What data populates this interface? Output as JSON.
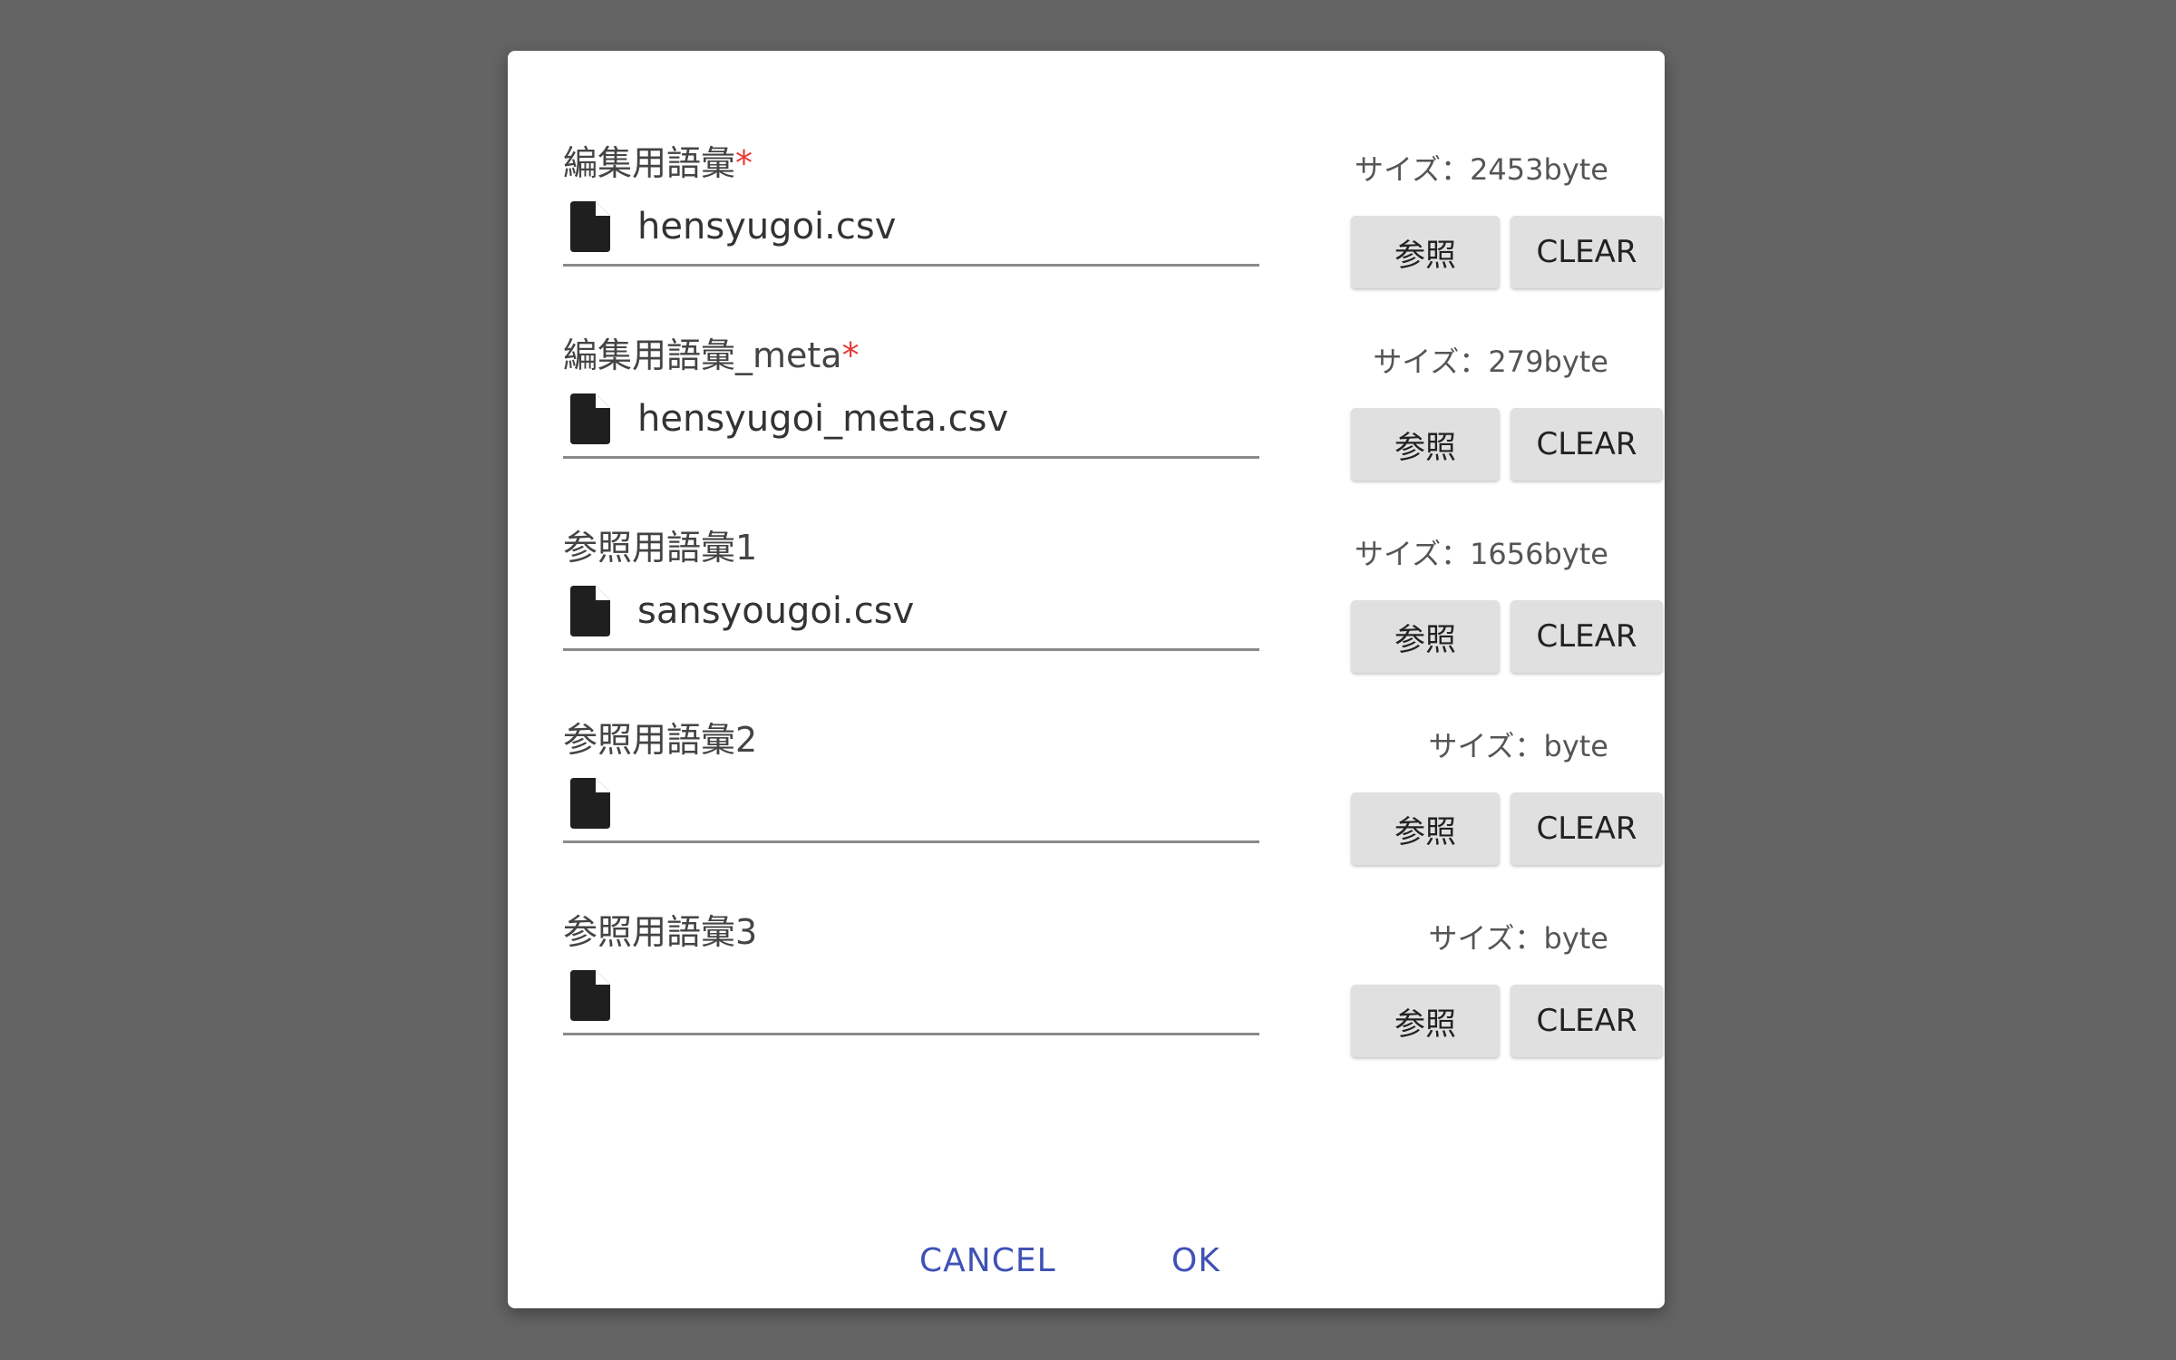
{
  "fields": [
    {
      "label": "編集用語彙",
      "required_mark": "*",
      "size_text": "サイズ：2453byte",
      "file_name": "hensyugoi.csv",
      "browse_label": "参照",
      "clear_label": "CLEAR"
    },
    {
      "label": "編集用語彙_meta",
      "required_mark": "*",
      "size_text": "サイズ：279byte",
      "file_name": "hensyugoi_meta.csv",
      "browse_label": "参照",
      "clear_label": "CLEAR"
    },
    {
      "label": "参照用語彙1",
      "required_mark": "",
      "size_text": "サイズ：1656byte",
      "file_name": "sansyougoi.csv",
      "browse_label": "参照",
      "clear_label": "CLEAR"
    },
    {
      "label": "参照用語彙2",
      "required_mark": "",
      "size_text": "サイズ：byte",
      "file_name": "",
      "browse_label": "参照",
      "clear_label": "CLEAR"
    },
    {
      "label": "参照用語彙3",
      "required_mark": "",
      "size_text": "サイズ：byte",
      "file_name": "",
      "browse_label": "参照",
      "clear_label": "CLEAR"
    }
  ],
  "actions": {
    "cancel_label": "CANCEL",
    "ok_label": "OK"
  },
  "icons": {
    "file": "file-icon"
  },
  "colors": {
    "overlay": "#646464",
    "dialog": "#ffffff",
    "required": "#e53935",
    "primary": "#3f51b5",
    "button": "#e0e0e0"
  }
}
